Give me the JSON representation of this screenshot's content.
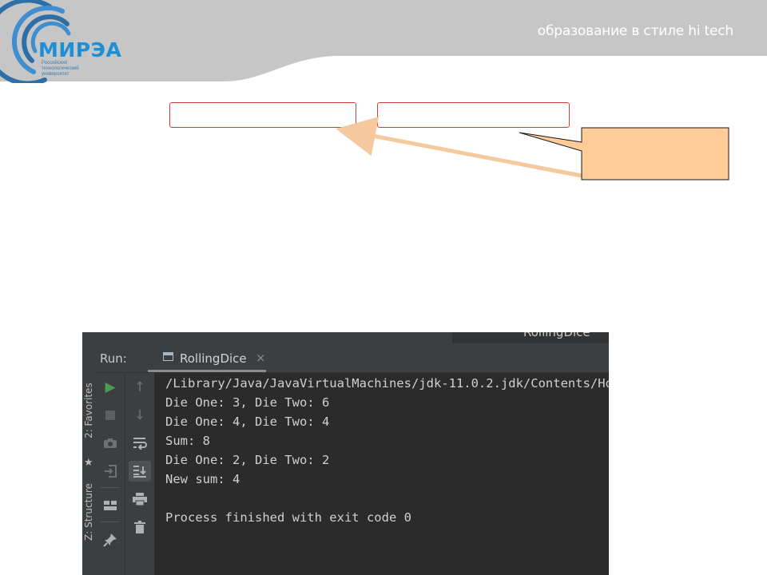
{
  "header": {
    "logo_text": "МИРЭА",
    "logo_subtitle": [
      "Российский",
      "технологический",
      "университет"
    ],
    "tagline": "образование в стиле hi tech"
  },
  "colors": {
    "header_gray": "#c6c6c6",
    "logo_blue": "#1e8fd6",
    "frame_red": "#d33c3c",
    "callout_fill": "#ffcc99",
    "arrow_color": "#f5c89e",
    "ide_background": "#2b2b2b",
    "ide_panel": "#3c3f41",
    "play_green": "#499c54"
  },
  "ide": {
    "top_tab": "RollingDice",
    "side_labels": {
      "favorites": "2: Favorites",
      "structure": "Z: Structure"
    },
    "run_label": "Run:",
    "run_tab": {
      "label": "RollingDice",
      "close": "×"
    },
    "toolbar_left_icons": [
      "play-icon",
      "stop-icon",
      "camera-icon",
      "login-icon",
      "layout-icon",
      "pin-icon"
    ],
    "toolbar_right_icons": [
      "arrow-up-icon",
      "arrow-down-icon",
      "soft-wrap-icon",
      "scroll-to-end-icon",
      "print-icon",
      "trash-icon"
    ],
    "console_lines": [
      "/Library/Java/JavaVirtualMachines/jdk-11.0.2.jdk/Contents/Ho",
      "Die One: 3, Die Two: 6",
      "Die One: 4, Die Two: 4",
      "Sum: 8",
      "Die One: 2, Die Two: 2",
      "New sum: 4",
      "",
      "Process finished with exit code 0"
    ]
  }
}
